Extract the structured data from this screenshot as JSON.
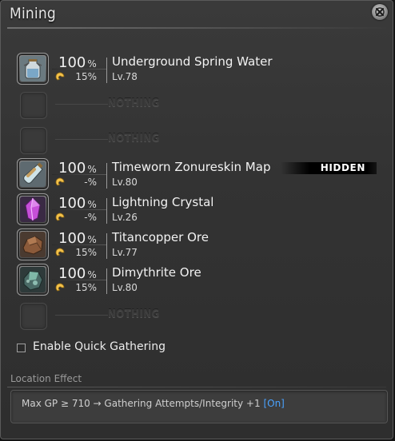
{
  "window": {
    "title": "Mining",
    "percent_unit": "%",
    "nothing_label": "NOTHING",
    "hidden_label": "HIDDEN",
    "level_prefix": "Lv."
  },
  "slots": [
    {
      "type": "item",
      "name": "Underground Spring Water",
      "success_rate": "100",
      "hq_chance": "15%",
      "level": "Lv.78",
      "icon": "water-jar-icon",
      "hidden": false
    },
    {
      "type": "empty",
      "label": "NOTHING"
    },
    {
      "type": "empty",
      "label": "NOTHING"
    },
    {
      "type": "item",
      "name": "Timeworn Zonureskin Map",
      "success_rate": "100",
      "hq_chance": "-%",
      "level": "Lv.80",
      "icon": "map-bottle-icon",
      "hidden": true,
      "hidden_label": "HIDDEN"
    },
    {
      "type": "item",
      "name": "Lightning Crystal",
      "success_rate": "100",
      "hq_chance": "-%",
      "level": "Lv.26",
      "icon": "lightning-crystal-icon",
      "hidden": false
    },
    {
      "type": "item",
      "name": "Titancopper Ore",
      "success_rate": "100",
      "hq_chance": "15%",
      "level": "Lv.77",
      "icon": "titancopper-ore-icon",
      "hidden": false
    },
    {
      "type": "item",
      "name": "Dimythrite Ore",
      "success_rate": "100",
      "hq_chance": "15%",
      "level": "Lv.80",
      "icon": "dimythrite-ore-icon",
      "hidden": false
    },
    {
      "type": "empty",
      "label": "NOTHING"
    }
  ],
  "quick_gathering": {
    "label": "Enable Quick Gathering",
    "checked": false
  },
  "location_effect": {
    "heading": "Location Effect",
    "text": "Max GP ≥ 710 → Gathering Attempts/Integrity +1",
    "status": "[On]",
    "status_color": "#4aa3ff"
  },
  "colors": {
    "background": "#333333",
    "accent_on": "#4aa3ff"
  }
}
